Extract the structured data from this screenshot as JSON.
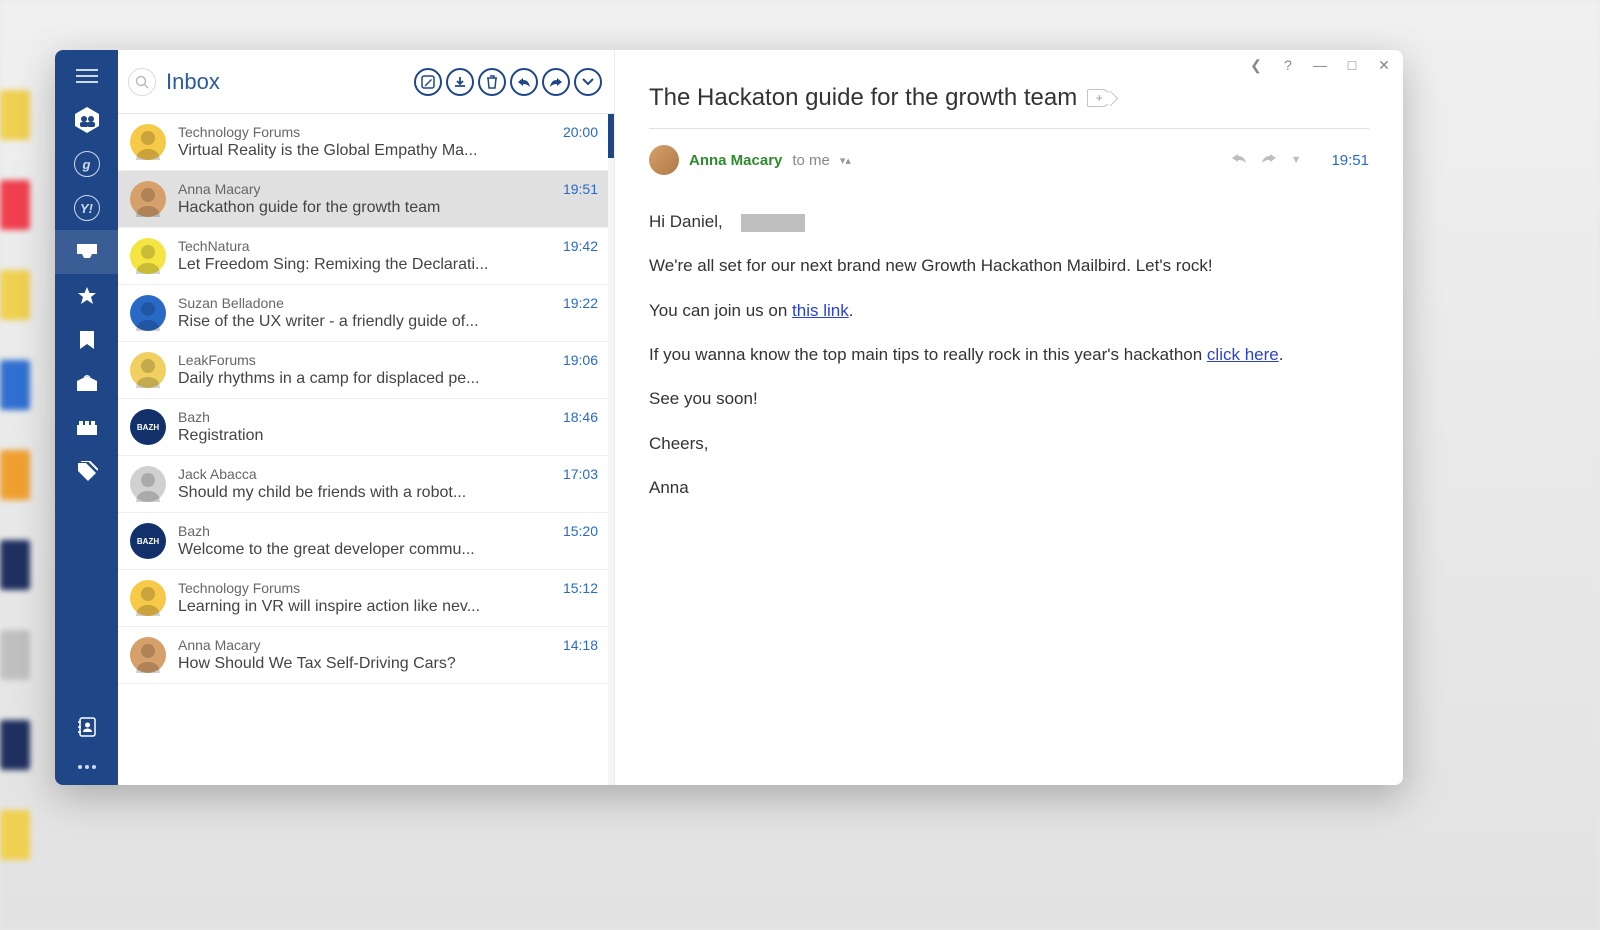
{
  "sidebar": {
    "icons": [
      "hamburger",
      "contacts-hex",
      "google-circle",
      "yahoo-circle",
      "inbox",
      "star",
      "bookmark",
      "sent",
      "archive",
      "tag",
      "addressbook",
      "ellipsis"
    ]
  },
  "list": {
    "title": "Inbox",
    "tools": [
      "compose",
      "download",
      "delete",
      "reply",
      "forward",
      "more"
    ],
    "messages": [
      {
        "sender": "Technology Forums",
        "subject": "Virtual Reality is the Global Empathy Ma...",
        "time": "20:00",
        "avatar": {
          "bg": "#f7c948",
          "svg": "face"
        }
      },
      {
        "sender": "Anna Macary",
        "subject": "Hackathon guide for the growth team",
        "time": "19:51",
        "avatar": {
          "bg": "#d6a06b",
          "svg": "anna"
        },
        "selected": true
      },
      {
        "sender": "TechNatura",
        "subject": "Let Freedom Sing: Remixing the Declarati...",
        "time": "19:42",
        "avatar": {
          "bg": "#f4e542",
          "svg": "deer"
        }
      },
      {
        "sender": "Suzan Belladone",
        "subject": "Rise of the UX writer - a friendly guide of...",
        "time": "19:22",
        "avatar": {
          "bg": "#2a6ac7",
          "svg": "suzan"
        }
      },
      {
        "sender": "LeakForums",
        "subject": "Daily rhythms in a camp for displaced pe...",
        "time": "19:06",
        "avatar": {
          "bg": "#f0d060",
          "svg": "lego"
        }
      },
      {
        "sender": "Bazh",
        "subject": "Registration",
        "time": "18:46",
        "avatar": {
          "bg": "#12306a",
          "text": "BAZH"
        }
      },
      {
        "sender": "Jack Abacca",
        "subject": "Should my child be friends with a robot...",
        "time": "17:03",
        "avatar": {
          "bg": "#d0d0d0",
          "svg": "jack"
        }
      },
      {
        "sender": "Bazh",
        "subject": "Welcome to the great developer commu...",
        "time": "15:20",
        "avatar": {
          "bg": "#12306a",
          "text": "BAZH"
        }
      },
      {
        "sender": "Technology Forums",
        "subject": "Learning in VR will inspire action like nev...",
        "time": "15:12",
        "avatar": {
          "bg": "#f7c948",
          "svg": "face"
        }
      },
      {
        "sender": "Anna Macary",
        "subject": "How Should We Tax Self-Driving Cars?",
        "time": "14:18",
        "avatar": {
          "bg": "#d6a06b",
          "svg": "anna"
        }
      }
    ]
  },
  "read": {
    "title": "The Hackaton guide for the growth team",
    "from": "Anna Macary",
    "to": "to me",
    "time": "19:51",
    "body": {
      "greeting": "Hi Daniel,",
      "p1": "We're all set for our next brand new Growth Hackathon Mailbird. Let's rock!",
      "p2a": "You can join us on ",
      "link1": "this link",
      "p2b": ".",
      "p3a": "If you wanna know the top main tips to really rock in this year's hackathon ",
      "link2": "click here",
      "p3b": ".",
      "p4": "See you soon!",
      "p5": "Cheers,",
      "p6": "Anna"
    }
  },
  "windowControls": [
    "back",
    "help",
    "minimize",
    "maximize",
    "close"
  ]
}
